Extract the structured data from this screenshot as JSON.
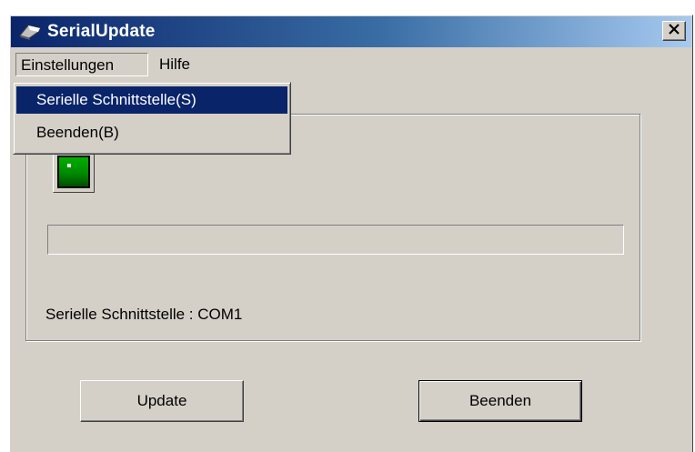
{
  "window": {
    "title": "SerialUpdate",
    "app_icon": "joystick-icon",
    "close_icon": "close-icon"
  },
  "menubar": {
    "items": [
      {
        "label": "Einstellungen",
        "state": "open"
      },
      {
        "label": "Hilfe"
      }
    ]
  },
  "dropdown": {
    "items": [
      {
        "label": "Serielle Schnittstelle(S)",
        "selected": true
      },
      {
        "label": "Beenden(B)",
        "selected": false
      }
    ]
  },
  "status_indicator": {
    "icon": "led-indicator-icon",
    "color": "#00a000"
  },
  "progress": {
    "value": 0
  },
  "status_text": "Serielle Schnittstelle : COM1",
  "buttons": {
    "update_label": "Update",
    "beenden_label": "Beenden"
  },
  "colors": {
    "face": "#d4d0c8",
    "titlebar_start": "#0a246a",
    "titlebar_end": "#a6caf0",
    "selection": "#0a246a"
  }
}
